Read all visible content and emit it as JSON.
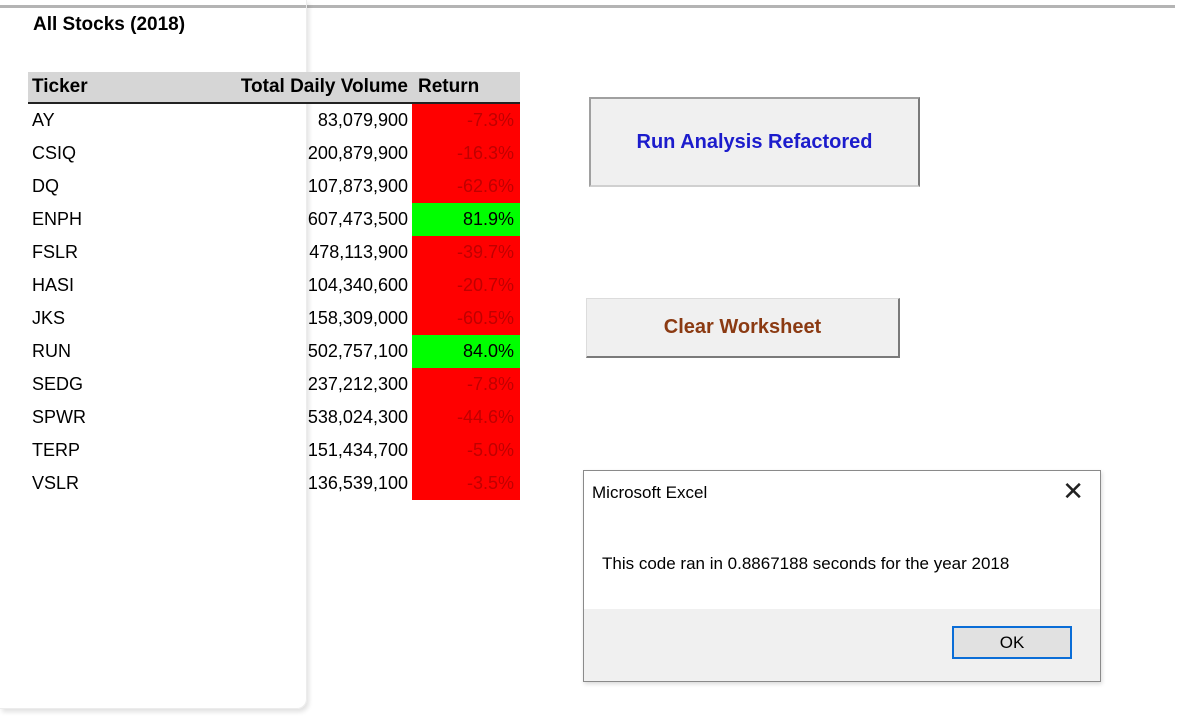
{
  "sheet": {
    "title": "All Stocks (2018)",
    "columns": [
      "Ticker",
      "Total Daily Volume",
      "Return"
    ],
    "rows": [
      {
        "ticker": "AY",
        "volume": "83,079,900",
        "return": "-7.3%",
        "positive": false
      },
      {
        "ticker": "CSIQ",
        "volume": "200,879,900",
        "return": "-16.3%",
        "positive": false
      },
      {
        "ticker": "DQ",
        "volume": "107,873,900",
        "return": "-62.6%",
        "positive": false
      },
      {
        "ticker": "ENPH",
        "volume": "607,473,500",
        "return": "81.9%",
        "positive": true
      },
      {
        "ticker": "FSLR",
        "volume": "478,113,900",
        "return": "-39.7%",
        "positive": false
      },
      {
        "ticker": "HASI",
        "volume": "104,340,600",
        "return": "-20.7%",
        "positive": false
      },
      {
        "ticker": "JKS",
        "volume": "158,309,000",
        "return": "-60.5%",
        "positive": false
      },
      {
        "ticker": "RUN",
        "volume": "502,757,100",
        "return": "84.0%",
        "positive": true
      },
      {
        "ticker": "SEDG",
        "volume": "237,212,300",
        "return": "-7.8%",
        "positive": false
      },
      {
        "ticker": "SPWR",
        "volume": "538,024,300",
        "return": "-44.6%",
        "positive": false
      },
      {
        "ticker": "TERP",
        "volume": "151,434,700",
        "return": "-5.0%",
        "positive": false
      },
      {
        "ticker": "VSLR",
        "volume": "136,539,100",
        "return": "-3.5%",
        "positive": false
      }
    ]
  },
  "buttons": {
    "run_label": "Run Analysis Refactored",
    "clear_label": "Clear Worksheet"
  },
  "dialog": {
    "title": "Microsoft Excel",
    "message": "This code ran in 0.8867188 seconds for the year 2018",
    "ok_label": "OK",
    "close_icon": "close-icon"
  },
  "colors": {
    "positive_fill": "#00ff00",
    "negative_fill": "#ff0000",
    "negative_text": "#c00000",
    "run_button_text": "#1c1ccc",
    "clear_button_text": "#8b3a12",
    "header_fill": "#d6d6d6"
  }
}
